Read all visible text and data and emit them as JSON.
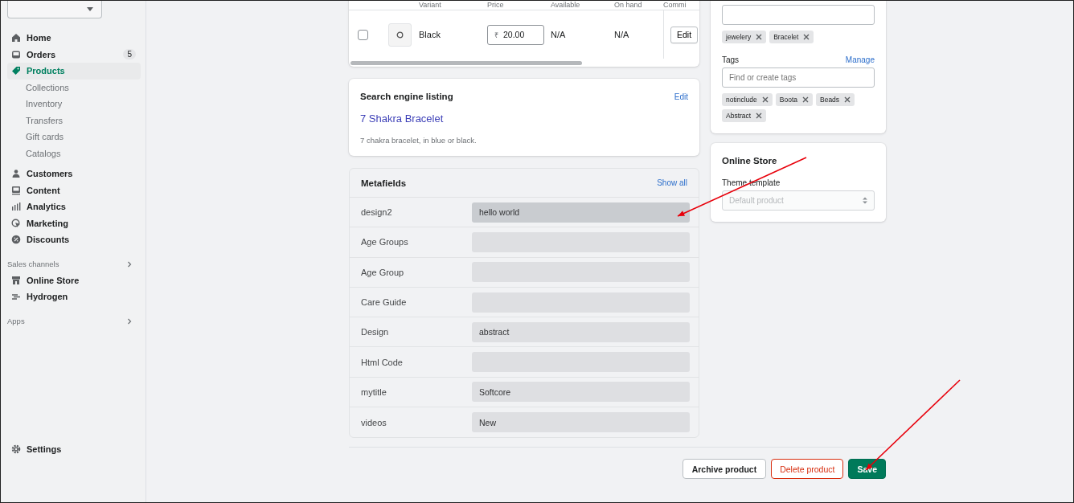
{
  "sidebar": {
    "items": [
      {
        "label": "Home",
        "selected": false
      },
      {
        "label": "Orders",
        "badge": "5",
        "selected": false
      },
      {
        "label": "Products",
        "selected": true,
        "children": [
          {
            "label": "Collections",
            "selected": false
          },
          {
            "label": "Inventory",
            "selected": false
          },
          {
            "label": "Transfers",
            "selected": false
          },
          {
            "label": "Gift cards",
            "selected": false
          },
          {
            "label": "Catalogs",
            "selected": false
          }
        ]
      },
      {
        "label": "Customers",
        "selected": false
      },
      {
        "label": "Content",
        "selected": false
      },
      {
        "label": "Analytics",
        "selected": false
      },
      {
        "label": "Marketing",
        "selected": false
      },
      {
        "label": "Discounts",
        "selected": false
      }
    ],
    "sales_channels": {
      "title": "Sales channels",
      "items": [
        {
          "label": "Online Store",
          "selected": false
        },
        {
          "label": "Hydrogen",
          "selected": false
        }
      ]
    },
    "apps": {
      "title": "Apps"
    },
    "settings": {
      "label": "Settings",
      "selected": false
    }
  },
  "variants": {
    "columns": [
      "Variant",
      "Price",
      "Available",
      "On hand",
      "Commi"
    ],
    "rows": [
      {
        "checked": false,
        "variant": "Black",
        "currency": "₹",
        "price": "20.00",
        "available": "N/A",
        "on_hand": "N/A",
        "action": "Edit"
      }
    ]
  },
  "seo": {
    "title": "Search engine listing",
    "edit": "Edit",
    "page_title": "7 Shakra Bracelet",
    "description": "7 chakra bracelet, in blue or black."
  },
  "metafields": {
    "title": "Metafields",
    "show_all": "Show all",
    "rows": [
      {
        "name": "design2",
        "value": "hello world",
        "focused": true
      },
      {
        "name": "Age Groups",
        "focused": false
      },
      {
        "name": "Age Group",
        "focused": false
      },
      {
        "name": "Care Guide",
        "focused": false
      },
      {
        "name": "Design",
        "value": "abstract",
        "focused": false
      },
      {
        "name": "Html Code",
        "focused": false
      },
      {
        "name": "mytitle",
        "value": "Softcore",
        "focused": false
      },
      {
        "name": "videos",
        "value": "New",
        "focused": false
      }
    ]
  },
  "organization": {
    "collections": [
      "jewelery",
      "Bracelet"
    ],
    "tags": {
      "label": "Tags",
      "manage": "Manage",
      "placeholder": "Find or create tags",
      "chips": [
        "notinclude",
        "Boota",
        "Beads",
        "Abstract"
      ]
    }
  },
  "online_store": {
    "title": "Online Store",
    "template_label": "Theme template",
    "template_value": "Default product",
    "disabled": true
  },
  "actions": [
    {
      "label": "Archive product",
      "kind": "secondary"
    },
    {
      "label": "Delete product",
      "kind": "destructive"
    },
    {
      "label": "Save",
      "kind": "primary"
    }
  ]
}
